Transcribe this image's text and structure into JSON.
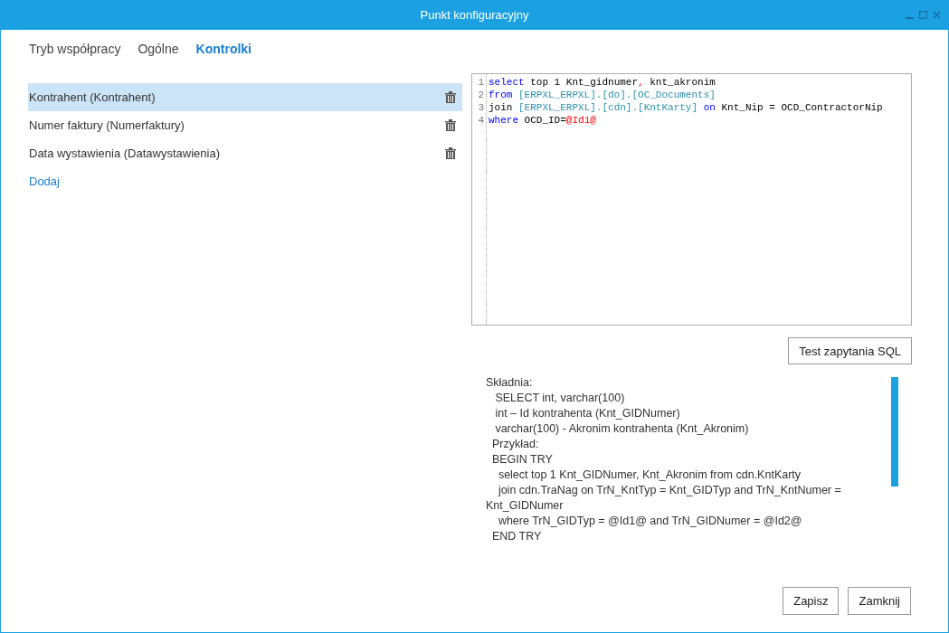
{
  "window": {
    "title": "Punkt konfiguracyjny"
  },
  "tabs": [
    {
      "label": "Tryb współpracy",
      "selected": false
    },
    {
      "label": "Ogólne",
      "selected": false
    },
    {
      "label": "Kontrolki",
      "selected": true
    }
  ],
  "controls": [
    {
      "label": "Kontrahent (Kontrahent)",
      "selected": true
    },
    {
      "label": "Numer faktury (Numerfaktury)",
      "selected": false
    },
    {
      "label": "Data wystawienia (Datawystawienia)",
      "selected": false
    }
  ],
  "add_link": "Dodaj",
  "editor": {
    "lines": [
      {
        "number": "1",
        "tokens": [
          {
            "kind": "keyword",
            "text": "select"
          },
          {
            "kind": "plain",
            "text": " top 1 Knt_gidnumer"
          },
          {
            "kind": "operator",
            "text": ","
          },
          {
            "kind": "plain",
            "text": " knt_akronim"
          }
        ]
      },
      {
        "number": "2",
        "tokens": [
          {
            "kind": "keyword",
            "text": "from"
          },
          {
            "kind": "object",
            "text": " [ERPXL_ERPXL].[do].[OC_Documents]"
          }
        ]
      },
      {
        "number": "3",
        "tokens": [
          {
            "kind": "plain",
            "text": "join "
          },
          {
            "kind": "object",
            "text": "[ERPXL_ERPXL].[cdn].[KntKarty]"
          },
          {
            "kind": "keyword",
            "text": " on"
          },
          {
            "kind": "plain",
            "text": " Knt_Nip = OCD_ContractorNip"
          }
        ]
      },
      {
        "number": "4",
        "tokens": [
          {
            "kind": "keyword",
            "text": "where"
          },
          {
            "kind": "plain",
            "text": " OCD_ID="
          },
          {
            "kind": "operator",
            "text": "@Id1@"
          }
        ]
      }
    ]
  },
  "test_button": "Test zapytania SQL",
  "help_lines": [
    "Składnia:",
    "   SELECT int, varchar(100)",
    "   int – Id kontrahenta (Knt_GIDNumer)",
    "   varchar(100) - Akronim kontrahenta (Knt_Akronim)",
    "  Przykład:",
    "  BEGIN TRY",
    "    select top 1 Knt_GIDNumer, Knt_Akronim from cdn.KntKarty",
    "    join cdn.TraNag on TrN_KntTyp = Knt_GIDTyp and TrN_KntNumer =",
    "Knt_GIDNumer",
    "    where TrN_GIDTyp = @Id1@ and TrN_GIDNumer = @Id2@",
    "  END TRY"
  ],
  "buttons": [
    "Zapisz",
    "Zamknij"
  ]
}
